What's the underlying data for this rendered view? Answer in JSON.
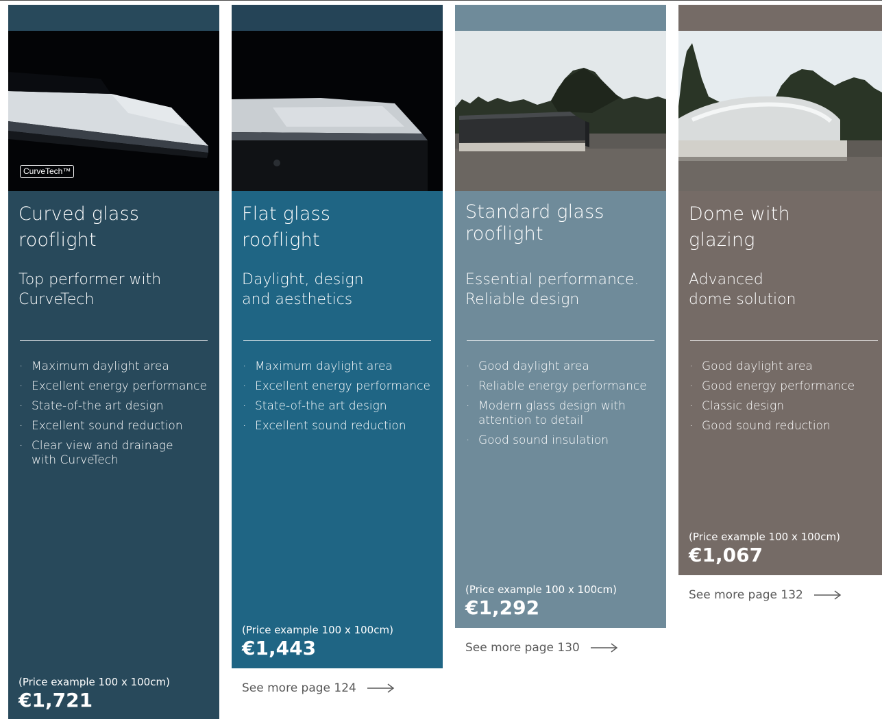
{
  "colors": {
    "card1": "#28495b",
    "card2": "#1f6584",
    "card3": "#6f8b9a",
    "card4": "#756b66",
    "band2": "#254457"
  },
  "cards": [
    {
      "title": "Curved glass rooflight",
      "subtitle": "Top performer with CurveTech",
      "badge_text": "CurveTech™",
      "features": [
        "Maximum daylight area",
        "Excellent energy performance",
        "State-of-the art design",
        "Excellent sound reduction",
        "Clear view and drainage with CurveTech"
      ],
      "price_note": "(Price example 100 x 100cm)",
      "price": "€1,721"
    },
    {
      "title": "Flat glass rooflight",
      "subtitle": "Daylight, design and aesthetics",
      "features": [
        "Maximum daylight area",
        "Excellent energy performance",
        "State-of-the art design",
        "Excellent sound reduction"
      ],
      "price_note": "(Price example 100 x 100cm)",
      "price": "€1,443",
      "see_more": "See more page 124"
    },
    {
      "title": "Standard glass rooflight",
      "subtitle": "Essential performance. Reliable design",
      "features": [
        "Good daylight area",
        "Reliable energy performance",
        "Modern glass design with attention to detail",
        "Good sound insulation"
      ],
      "price_note": "(Price example 100 x 100cm)",
      "price": "€1,292",
      "see_more": "See more page 130"
    },
    {
      "title": "Dome with glazing",
      "subtitle": "Advanced dome solution",
      "features": [
        "Good daylight area",
        "Good energy performance",
        "Classic design",
        "Good sound reduction"
      ],
      "price_note": "(Price example 100 x 100cm)",
      "price": "€1,067",
      "see_more": "See more page 132"
    }
  ]
}
